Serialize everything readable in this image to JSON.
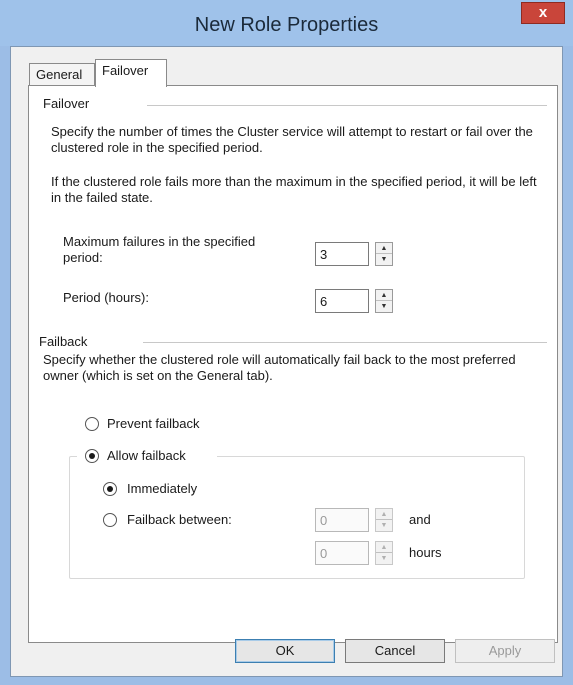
{
  "window": {
    "title": "New Role Properties",
    "close_label": "x"
  },
  "tabs": [
    {
      "label": "General",
      "selected": false
    },
    {
      "label": "Failover",
      "selected": true
    }
  ],
  "failover": {
    "group_title": "Failover",
    "description": "Specify the number of times the Cluster service will attempt to restart or fail over the clustered role in the specified period.",
    "note": "If the clustered role fails more than the maximum in the specified period, it will be left in the failed state.",
    "max_failures_label": "Maximum failures in the specified period:",
    "max_failures_value": "3",
    "period_label": "Period (hours):",
    "period_value": "6"
  },
  "failback": {
    "group_title": "Failback",
    "description": "Specify whether the clustered role will automatically fail back to the most preferred owner (which is set on the General tab).",
    "prevent_label": "Prevent failback",
    "prevent_checked": false,
    "allow_label": "Allow failback",
    "allow_checked": true,
    "immediately_label": "Immediately",
    "immediately_checked": true,
    "between_label": "Failback between:",
    "between_checked": false,
    "between_start_value": "0",
    "and_label": "and",
    "between_end_value": "0",
    "hours_label": "hours"
  },
  "buttons": {
    "ok": "OK",
    "cancel": "Cancel",
    "apply": "Apply"
  }
}
